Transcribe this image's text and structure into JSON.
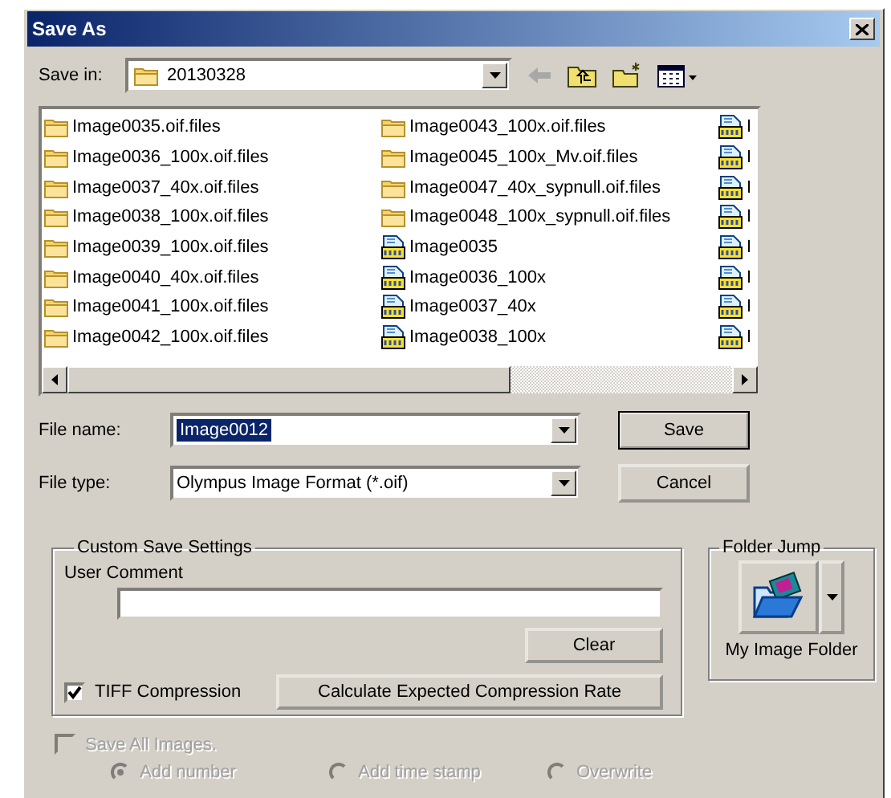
{
  "window": {
    "title": "Save As"
  },
  "save_in": {
    "label": "Save in:",
    "value": "20130328"
  },
  "file_list": {
    "columns": [
      [
        {
          "kind": "folder",
          "name": "Image0035.oif.files"
        },
        {
          "kind": "folder",
          "name": "Image0036_100x.oif.files"
        },
        {
          "kind": "folder",
          "name": "Image0037_40x.oif.files"
        },
        {
          "kind": "folder",
          "name": "Image0038_100x.oif.files"
        },
        {
          "kind": "folder",
          "name": "Image0039_100x.oif.files"
        },
        {
          "kind": "folder",
          "name": "Image0040_40x.oif.files"
        },
        {
          "kind": "folder",
          "name": "Image0041_100x.oif.files"
        },
        {
          "kind": "folder",
          "name": "Image0042_100x.oif.files"
        }
      ],
      [
        {
          "kind": "folder",
          "name": "Image0043_100x.oif.files"
        },
        {
          "kind": "folder",
          "name": "Image0045_100x_Mv.oif.files"
        },
        {
          "kind": "folder",
          "name": "Image0047_40x_sypnull.oif.files"
        },
        {
          "kind": "folder",
          "name": "Image0048_100x_sypnull.oif.files"
        },
        {
          "kind": "oif",
          "name": "Image0035"
        },
        {
          "kind": "oif",
          "name": "Image0036_100x"
        },
        {
          "kind": "oif",
          "name": "Image0037_40x"
        },
        {
          "kind": "oif",
          "name": "Image0038_100x"
        }
      ],
      [
        {
          "kind": "oif",
          "name": "I"
        },
        {
          "kind": "oif",
          "name": "I"
        },
        {
          "kind": "oif",
          "name": "I"
        },
        {
          "kind": "oif",
          "name": "I"
        },
        {
          "kind": "oif",
          "name": "I"
        },
        {
          "kind": "oif",
          "name": "I"
        },
        {
          "kind": "oif",
          "name": "I"
        },
        {
          "kind": "oif",
          "name": "I"
        }
      ]
    ]
  },
  "file_name": {
    "label": "File name:",
    "value": "Image0012",
    "selected": true
  },
  "file_type": {
    "label": "File type:",
    "value": "Olympus Image Format (*.oif)"
  },
  "save_button": "Save",
  "cancel_button": "Cancel",
  "custom_save_settings": {
    "title": "Custom Save Settings",
    "user_comment_label": "User Comment",
    "clear_button": "Clear",
    "tiff_compression": {
      "label": "TIFF Compression",
      "checked": true
    },
    "calculate_button": "Calculate Expected Compression Rate"
  },
  "folder_jump": {
    "title": "Folder Jump",
    "label": "My Image Folder"
  },
  "save_all_images": {
    "label": "Save All Images.",
    "checked": false,
    "disabled": true
  },
  "naming_options": [
    {
      "label": "Add number",
      "selected": true,
      "disabled": true
    },
    {
      "label": "Add time stamp",
      "selected": false,
      "disabled": true
    },
    {
      "label": "Overwrite",
      "selected": false,
      "disabled": true
    }
  ]
}
